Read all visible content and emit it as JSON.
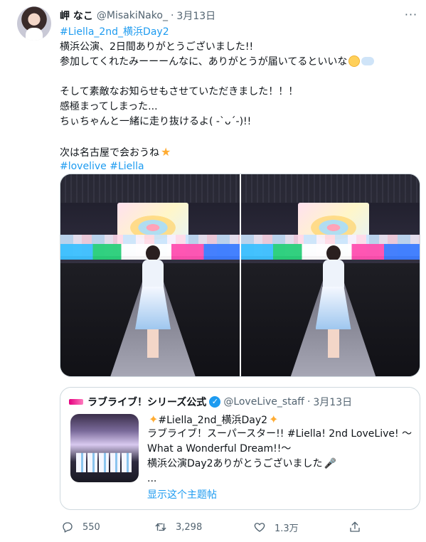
{
  "tweet": {
    "author": {
      "name": "岬 なこ",
      "handle": "@MisakiNako_",
      "dot": "·",
      "date": "3月13日"
    },
    "more_label": "···",
    "lines": [
      {
        "kind": "link",
        "text": "#Liella_2nd_横浜Day2"
      },
      {
        "kind": "text",
        "text": "横浜公演、2日間ありがとうございました!!"
      },
      {
        "kind": "text",
        "text": "参加してくれたみーーーんなに、ありがとうが届いてるといいな"
      },
      {
        "kind": "spacer",
        "text": ""
      },
      {
        "kind": "text",
        "text": "そして素敵なお知らせもさせていただきました！！！"
      },
      {
        "kind": "text",
        "text": "感極まってしまった..."
      },
      {
        "kind": "text",
        "text": "ちぃちゃんと一緒に走り抜けるよ( -`ᴗ´-)!!"
      },
      {
        "kind": "spacer",
        "text": ""
      },
      {
        "kind": "text",
        "text": "次は名古屋で会おうね"
      },
      {
        "kind": "link",
        "text": "#lovelive #Liella"
      }
    ],
    "emoji_line2": [
      "relieved-face",
      "thought-balloon"
    ],
    "emoji_line8": "star",
    "media": [
      {
        "icon": "photo-front-pose"
      },
      {
        "icon": "photo-back-pose"
      }
    ]
  },
  "quote": {
    "author": {
      "name": "ラブライブ！シリーズ公式",
      "handle": "@LoveLive_staff",
      "dot": "·",
      "date": "3月13日"
    },
    "lines": [
      "#Liella_2nd_横浜Day2",
      "ラブライブ！スーパースター!! #Liella! 2nd LoveLive! ～",
      "What a Wonderful Dream!!～",
      "横浜公演Day2ありがとうございました",
      "..."
    ],
    "show_thread": "显示这个主题帖"
  },
  "actions": {
    "reply_count": "550",
    "retweet_count": "3,298",
    "like_count": "1.3万"
  },
  "colors": {
    "link": "#1d9bf0",
    "text": "#0f1419",
    "muted": "#536471",
    "border": "#cfd9de"
  }
}
